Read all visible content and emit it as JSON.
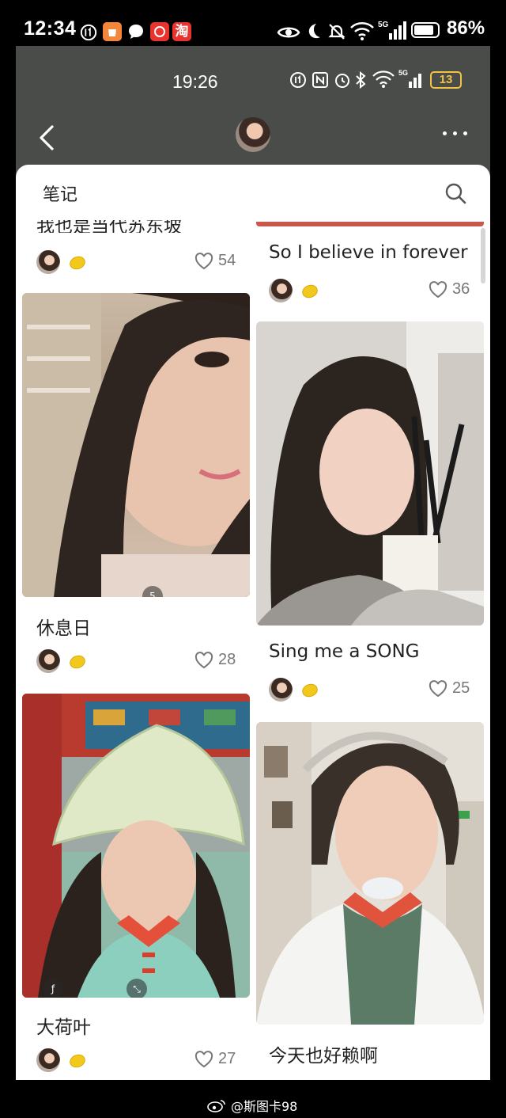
{
  "outer_status": {
    "time": "12:34",
    "notification_icons": [
      "notification-badge-icon",
      "shopping-app-icon",
      "chat-bubble-icon",
      "red-app-icon",
      "taobao-icon"
    ],
    "notification_text": {
      "taobao": "淘"
    },
    "system_icons": [
      "eye-icon",
      "moon-icon",
      "mute-icon",
      "wifi-icon",
      "5g-signal-icon"
    ],
    "battery_percent": "86%",
    "battery_level": 0.86
  },
  "inner_status": {
    "time": "19:26",
    "battery_text": "13",
    "battery_color": "#f0c440"
  },
  "nav": {
    "back_icon": "chevron-left-icon",
    "more_icon": "more-dots-icon"
  },
  "panel": {
    "title": "笔记",
    "search_icon": "search-icon"
  },
  "cards": {
    "left": [
      {
        "title": "我也是当代苏东坡",
        "likes": "54"
      },
      {
        "title": "休息日",
        "likes": "28",
        "badge": "5"
      },
      {
        "title": "大荷叶",
        "likes": "27"
      }
    ],
    "right": [
      {
        "title": "So I believe in forever",
        "likes": "36"
      },
      {
        "title": "Sing me a SONG",
        "likes": "25"
      },
      {
        "title": "今天也好赖啊",
        "likes": ""
      }
    ]
  },
  "watermark": {
    "text": "@斯图卡98"
  },
  "colors": {
    "app_bar": "#4a4c4a",
    "panel": "#ffffff",
    "accent_lemon": "#f2c81c"
  }
}
